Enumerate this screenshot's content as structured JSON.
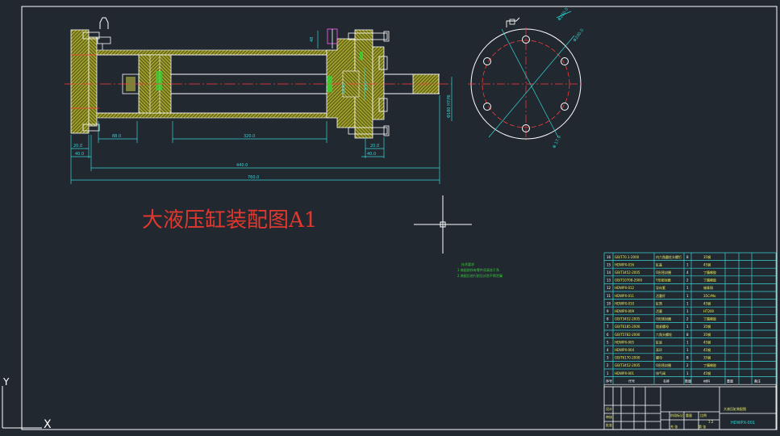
{
  "drawing": {
    "title": "大液压缸装配图A1",
    "dimensions": {
      "stroke": "48",
      "piston_len": "88.0",
      "chamber_len": "320.0",
      "left_flange": "20.0",
      "left_total": "40.0",
      "right_flange": "20.0",
      "right_total": "40.0",
      "body_len": "440.0",
      "overall_len": "760.0",
      "rod_dia": "Φ35",
      "bore_dia": "Φ140",
      "right_bore": "Φ180 H7/f6",
      "circle_top": "Φ250.0",
      "circle_mid": "Φ200.0",
      "circle_bottom": "Φ 17.0"
    },
    "notes": {
      "heading": "技术要求",
      "line1": "1.装配前所有零件须清洗干净",
      "line2": "2.装配后进行耐压试验不得泄漏"
    }
  },
  "bom": {
    "rows": [
      {
        "no": "16",
        "code": "GB/T70.1-2000",
        "name": "内六角圆柱头螺钉",
        "qty": "8",
        "mat": "35钢"
      },
      {
        "no": "15",
        "code": "HDWPX-016",
        "name": "缸盖",
        "qty": "1",
        "mat": "45钢"
      },
      {
        "no": "14",
        "code": "GB/T3452-2005",
        "name": "O形密封圈",
        "qty": "4",
        "mat": "丁腈橡胶"
      },
      {
        "no": "13",
        "code": "GB/T10708-2000",
        "name": "Y形密封圈",
        "qty": "2",
        "mat": "丁腈橡胶"
      },
      {
        "no": "12",
        "code": "HDWPX-012",
        "name": "导向套",
        "qty": "1",
        "mat": "锡青铜"
      },
      {
        "no": "11",
        "code": "HDWPX-011",
        "name": "活塞杆",
        "qty": "1",
        "mat": "35CrMo"
      },
      {
        "no": "10",
        "code": "HDWPX-010",
        "name": "缸筒",
        "qty": "1",
        "mat": "45钢"
      },
      {
        "no": "9",
        "code": "HDWPX-009",
        "name": "活塞",
        "qty": "1",
        "mat": "HT200"
      },
      {
        "no": "8",
        "code": "GB/T3452-2005",
        "name": "O形密封圈",
        "qty": "2",
        "mat": "丁腈橡胶"
      },
      {
        "no": "7",
        "code": "GB/T6185-2000",
        "name": "锁紧螺母",
        "qty": "1",
        "mat": "35钢"
      },
      {
        "no": "6",
        "code": "GB/T5782-2000",
        "name": "六角头螺栓",
        "qty": "8",
        "mat": "35钢"
      },
      {
        "no": "5",
        "code": "HDWPX-005",
        "name": "缸底",
        "qty": "1",
        "mat": "45钢"
      },
      {
        "no": "4",
        "code": "HDWPX-004",
        "name": "耳环",
        "qty": "1",
        "mat": "45钢"
      },
      {
        "no": "3",
        "code": "GB/T6170-2000",
        "name": "螺母",
        "qty": "8",
        "mat": "35钢"
      },
      {
        "no": "2",
        "code": "GB/T3452-2005",
        "name": "O形密封圈",
        "qty": "2",
        "mat": "丁腈橡胶"
      },
      {
        "no": "1",
        "code": "HDWPX-001",
        "name": "排气阀",
        "qty": "1",
        "mat": "45钢"
      }
    ],
    "header": {
      "no": "序号",
      "code": "代号",
      "name": "名称",
      "qty": "数量",
      "mat": "材料",
      "weight": "重量",
      "remark": "备注"
    },
    "title_block": {
      "name": "大液压缸装配图",
      "code": "HDWPX-001",
      "stage": "阶段标记",
      "weight": "重量",
      "scale_label": "比例",
      "scale": "1:2",
      "sheet_label": "共 张",
      "sheet": "第 张",
      "design": "设计",
      "check": "审核",
      "approve": "批准"
    }
  },
  "axes": {
    "y": "Y",
    "x": "X"
  }
}
